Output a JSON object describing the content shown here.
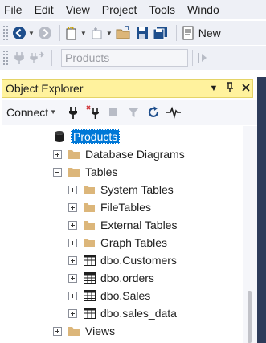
{
  "menu": [
    "File",
    "Edit",
    "View",
    "Project",
    "Tools",
    "Windo"
  ],
  "toolbar": {
    "new_query_label": "New",
    "database_combo": "Products"
  },
  "object_explorer": {
    "title": "Object Explorer",
    "connect_label": "Connect"
  },
  "tree": [
    {
      "label": "Products",
      "expander": "minus",
      "icon": "database-icon",
      "selected": true
    },
    {
      "label": "Database Diagrams",
      "expander": "plus",
      "icon": "folder-icon"
    },
    {
      "label": "Tables",
      "expander": "minus",
      "icon": "folder-icon"
    },
    {
      "label": "System Tables",
      "expander": "plus",
      "icon": "folder-icon"
    },
    {
      "label": "FileTables",
      "expander": "plus",
      "icon": "folder-icon"
    },
    {
      "label": "External Tables",
      "expander": "plus",
      "icon": "folder-icon"
    },
    {
      "label": "Graph Tables",
      "expander": "plus",
      "icon": "folder-icon"
    },
    {
      "label": "dbo.Customers",
      "expander": "plus",
      "icon": "table-icon"
    },
    {
      "label": "dbo.orders",
      "expander": "plus",
      "icon": "table-icon"
    },
    {
      "label": "dbo.Sales",
      "expander": "plus",
      "icon": "table-icon"
    },
    {
      "label": "dbo.sales_data",
      "expander": "plus",
      "icon": "table-icon"
    },
    {
      "label": "Views",
      "expander": "plus",
      "icon": "folder-icon"
    }
  ],
  "colors": {
    "title_bar": "#fff29d",
    "selection": "#0078d7",
    "folder": "#dcb67a",
    "dark_edge": "#2d3b5a"
  }
}
